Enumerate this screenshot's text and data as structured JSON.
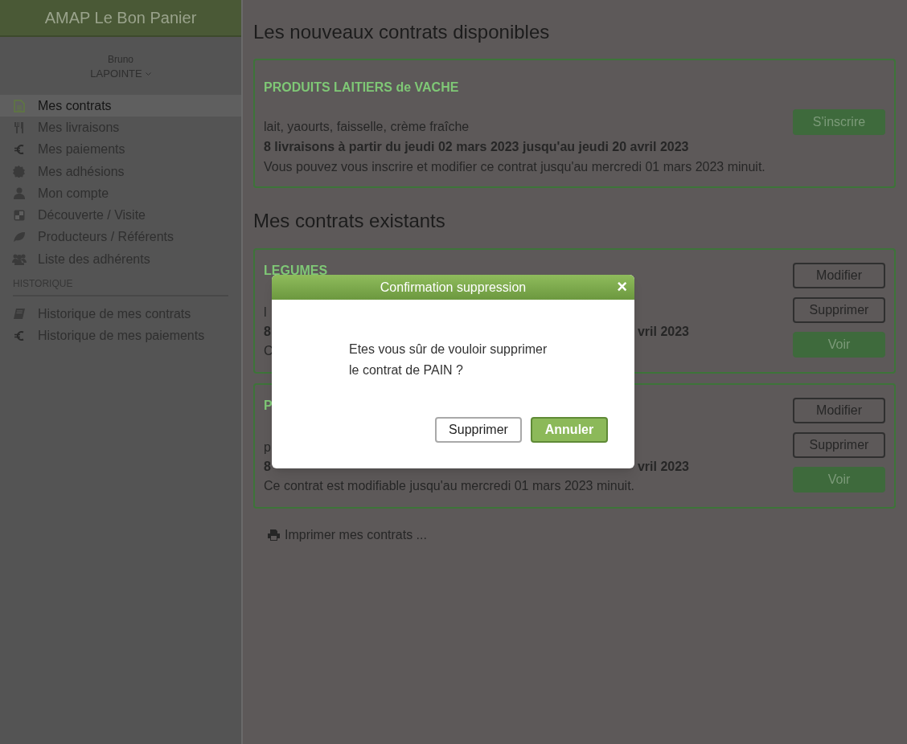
{
  "sidebar": {
    "title": "AMAP Le Bon Panier",
    "user": {
      "first_name": "Bruno",
      "last_name": "LAPOINTE"
    },
    "items": [
      {
        "label": "Mes contrats",
        "selected": true
      },
      {
        "label": "Mes livraisons",
        "selected": false
      },
      {
        "label": "Mes paiements",
        "selected": false
      },
      {
        "label": "Mes adhésions",
        "selected": false
      },
      {
        "label": "Mon compte",
        "selected": false
      },
      {
        "label": "Découverte / Visite",
        "selected": false
      },
      {
        "label": "Producteurs / Référents",
        "selected": false
      },
      {
        "label": "Liste des adhérents",
        "selected": false
      }
    ],
    "section_label": "HISTORIQUE",
    "history_items": [
      {
        "label": "Historique de mes contrats",
        "selected": false
      },
      {
        "label": "Historique de mes paiements",
        "selected": false
      }
    ]
  },
  "new_contracts": {
    "heading": "Les nouveaux contrats disponibles",
    "cards": [
      {
        "title": "PRODUITS LAITIERS de VACHE",
        "products": "lait, yaourts, faisselle, crème fraîche",
        "deliveries": "8 livraisons à partir du jeudi 02 mars 2023 jusqu'au jeudi 20 avril 2023",
        "note": "Vous pouvez vous inscrire et modifier ce contrat jusqu'au mercredi 01 mars 2023 minuit.",
        "button": "S'inscrire"
      }
    ]
  },
  "existing_contracts": {
    "heading": "Mes contrats existants",
    "cards": [
      {
        "title": "LEGUMES",
        "products": "l",
        "deliveries_start": "8",
        "deliveries_end": "vril 2023",
        "note": "C",
        "buttons": [
          {
            "label": "Modifier",
            "kind": "outline"
          },
          {
            "label": "Supprimer",
            "kind": "outline"
          },
          {
            "label": "Voir",
            "kind": "filled"
          }
        ]
      },
      {
        "title": "P",
        "products": "p",
        "deliveries_start": "8",
        "deliveries_end": "vril 2023",
        "note": "Ce contrat est modifiable jusqu'au mercredi 01 mars 2023 minuit.",
        "buttons": [
          {
            "label": "Modifier",
            "kind": "outline"
          },
          {
            "label": "Supprimer",
            "kind": "outline"
          },
          {
            "label": "Voir",
            "kind": "filled"
          }
        ]
      }
    ]
  },
  "print_link": "Imprimer mes contrats ...",
  "modal": {
    "title": "Confirmation suppression",
    "close": "×",
    "message_lines": [
      "Etes vous sûr de vouloir supprimer",
      "le contrat de PAIN ?"
    ],
    "buttons": [
      {
        "label": "Supprimer",
        "kind": "outline"
      },
      {
        "label": "Annuler",
        "kind": "primary"
      }
    ]
  }
}
